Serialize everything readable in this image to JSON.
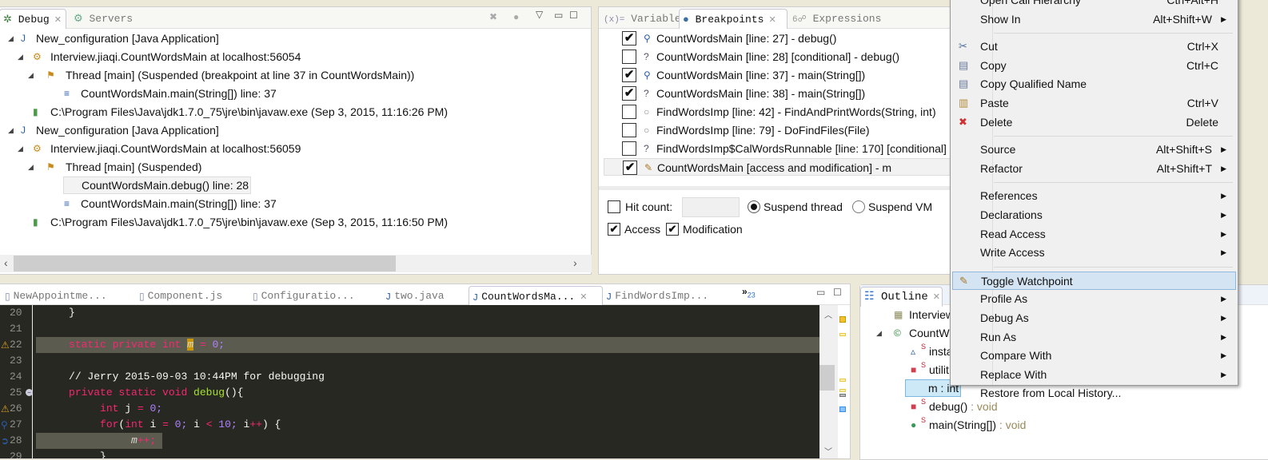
{
  "debug_panel": {
    "tabs": [
      {
        "label": "Debug",
        "icon": "bug-icon",
        "active": true
      },
      {
        "label": "Servers",
        "icon": "servers-icon",
        "active": false
      }
    ],
    "tree": [
      {
        "level": 0,
        "toggle": true,
        "icon": "java-app-icon",
        "label": "New_configuration [Java Application]"
      },
      {
        "level": 1,
        "toggle": true,
        "icon": "gears-icon",
        "label": "Interview.jiaqi.CountWordsMain at localhost:56054"
      },
      {
        "level": 2,
        "toggle": true,
        "icon": "thread-icon",
        "label": "Thread [main] (Suspended (breakpoint at line 37 in CountWordsMain))"
      },
      {
        "level": 3,
        "toggle": false,
        "icon": "stack-frame-icon",
        "label": "CountWordsMain.main(String[]) line: 37"
      },
      {
        "level": 1,
        "toggle": false,
        "icon": "process-icon",
        "label": "C:\\Program Files\\Java\\jdk1.7.0_75\\jre\\bin\\javaw.exe (Sep 3, 2015, 11:16:26 PM)"
      },
      {
        "level": 0,
        "toggle": true,
        "icon": "java-app-icon",
        "label": "New_configuration [Java Application]"
      },
      {
        "level": 1,
        "toggle": true,
        "icon": "gears-icon",
        "label": "Interview.jiaqi.CountWordsMain at localhost:56059"
      },
      {
        "level": 2,
        "toggle": true,
        "icon": "thread-icon",
        "label": "Thread [main] (Suspended)"
      },
      {
        "level": 3,
        "toggle": false,
        "icon": "stack-frame-icon",
        "label": "CountWordsMain.debug() line: 28",
        "selected": true
      },
      {
        "level": 3,
        "toggle": false,
        "icon": "stack-frame-icon",
        "label": "CountWordsMain.main(String[]) line: 37"
      },
      {
        "level": 1,
        "toggle": false,
        "icon": "process-icon",
        "label": "C:\\Program Files\\Java\\jdk1.7.0_75\\jre\\bin\\javaw.exe (Sep 3, 2015, 11:16:50 PM)"
      }
    ]
  },
  "breakpoints_panel": {
    "tabs": [
      {
        "label": "Variables",
        "icon": "variables-icon"
      },
      {
        "label": "Breakpoints",
        "icon": "breakpoints-icon",
        "active": true
      },
      {
        "label": "Expressions",
        "icon": "expressions-icon"
      }
    ],
    "items": [
      {
        "checked": true,
        "icon": "line-breakpoint-icon",
        "label": "CountWordsMain [line: 27] - debug()"
      },
      {
        "checked": false,
        "icon": "conditional-breakpoint-icon",
        "label": "CountWordsMain [line: 28] [conditional] - debug()"
      },
      {
        "checked": true,
        "icon": "line-breakpoint-icon",
        "label": "CountWordsMain [line: 37] - main(String[])"
      },
      {
        "checked": true,
        "icon": "conditional-breakpoint-icon",
        "label": "CountWordsMain [line: 38] - main(String[])"
      },
      {
        "checked": false,
        "icon": "disabled-breakpoint-icon",
        "label": "FindWordsImp [line: 42] - FindAndPrintWords(String, int)"
      },
      {
        "checked": false,
        "icon": "disabled-breakpoint-icon",
        "label": "FindWordsImp [line: 79] - DoFindFiles(File)"
      },
      {
        "checked": false,
        "icon": "conditional-breakpoint-icon",
        "label": "FindWordsImp$CalWordsRunnable [line: 170] [conditional]"
      },
      {
        "checked": true,
        "icon": "watchpoint-icon",
        "label": "CountWordsMain [access and modification] - m",
        "selected": true
      }
    ],
    "details": {
      "hit_count_label": "Hit count:",
      "hit_count_checked": false,
      "hit_count_value": "",
      "suspend_thread_label": "Suspend thread",
      "suspend_vm_label": "Suspend VM",
      "suspend_selected": "thread",
      "access_label": "Access",
      "access_checked": true,
      "modification_label": "Modification",
      "modification_checked": true
    }
  },
  "editor": {
    "tabs": [
      {
        "label": "NewAppointme...",
        "icon": "js-file-icon"
      },
      {
        "label": "Component.js",
        "icon": "js-file-icon"
      },
      {
        "label": "Configuratio...",
        "icon": "js-file-icon"
      },
      {
        "label": "two.java",
        "icon": "java-file-icon"
      },
      {
        "label": "CountWordsMa...",
        "icon": "java-file-icon",
        "active": true
      },
      {
        "label": "FindWordsImp...",
        "icon": "java-file-icon"
      }
    ],
    "overflow_count": "23",
    "lines": [
      {
        "n": "20",
        "tokens": [
          {
            "t": "\t}",
            "c": "plain"
          }
        ]
      },
      {
        "n": "21",
        "tokens": []
      },
      {
        "n": "22",
        "hl": "full",
        "marker": "warning-watchpoint-icon",
        "tokens": [
          {
            "t": "\t",
            "c": "plain"
          },
          {
            "t": "static private int ",
            "c": "keyword"
          },
          {
            "t": "m",
            "c": "field",
            "mark": true
          },
          {
            "t": " = ",
            "c": "op"
          },
          {
            "t": "0;",
            "c": "number"
          }
        ]
      },
      {
        "n": "23",
        "tokens": []
      },
      {
        "n": "24",
        "tokens": [
          {
            "t": "\t// Jerry 2015-09-03 10:44PM for debugging",
            "c": "comment"
          }
        ]
      },
      {
        "n": "25",
        "fold": true,
        "tokens": [
          {
            "t": "\t",
            "c": "plain"
          },
          {
            "t": "private static void ",
            "c": "keyword"
          },
          {
            "t": "debug",
            "c": "func"
          },
          {
            "t": "(){",
            "c": "plain"
          }
        ]
      },
      {
        "n": "26",
        "marker": "warning-icon",
        "tokens": [
          {
            "t": "\t\t",
            "c": "plain"
          },
          {
            "t": "int ",
            "c": "keyword"
          },
          {
            "t": "j",
            "c": "plain"
          },
          {
            "t": " = ",
            "c": "op"
          },
          {
            "t": "0;",
            "c": "number"
          }
        ]
      },
      {
        "n": "27",
        "marker": "breakpoint-icon",
        "tokens": [
          {
            "t": "\t\t",
            "c": "plain"
          },
          {
            "t": "for",
            "c": "keyword"
          },
          {
            "t": "(",
            "c": "plain"
          },
          {
            "t": "int ",
            "c": "keyword"
          },
          {
            "t": "i",
            "c": "plain"
          },
          {
            "t": " = ",
            "c": "op"
          },
          {
            "t": "0; ",
            "c": "number"
          },
          {
            "t": "i ",
            "c": "plain"
          },
          {
            "t": "< ",
            "c": "op"
          },
          {
            "t": "10; ",
            "c": "number"
          },
          {
            "t": "i",
            "c": "plain"
          },
          {
            "t": "++",
            "c": "op"
          },
          {
            "t": ") {",
            "c": "plain"
          }
        ]
      },
      {
        "n": "28",
        "hl": "partial",
        "marker": "current-line-breakpoint-icon",
        "tokens": [
          {
            "t": "\t\t\t",
            "c": "plain"
          },
          {
            "t": "m",
            "c": "field"
          },
          {
            "t": "++;",
            "c": "op"
          }
        ]
      },
      {
        "n": "29",
        "tokens": [
          {
            "t": "\t\t}",
            "c": "plain"
          }
        ]
      }
    ]
  },
  "outline": {
    "tab_label": "Outline",
    "items": [
      {
        "level": 1,
        "icon": "package-icon",
        "label": "Interview",
        "suffix": ""
      },
      {
        "level": 1,
        "toggle": true,
        "icon": "class-icon",
        "label": "CountW",
        "suffix": ""
      },
      {
        "level": 2,
        "icon": "protected-field-icon",
        "static": "S",
        "label": "insta",
        "suffix": ""
      },
      {
        "level": 2,
        "icon": "private-field-icon",
        "static": "S",
        "label": "utilit",
        "suffix": ""
      },
      {
        "level": 2,
        "icon": "private-field-warning-icon",
        "static": "S",
        "label": "m : int",
        "suffix": "",
        "selected": true
      },
      {
        "level": 2,
        "icon": "private-method-warning-icon",
        "static": "S",
        "label": "debug()",
        "suffix": " : void"
      },
      {
        "level": 2,
        "icon": "public-method-icon",
        "static": "S",
        "label": "main(String[])",
        "suffix": " : void"
      }
    ]
  },
  "context_menu": {
    "items": [
      {
        "label": "Open Call Hierarchy",
        "shortcut": "Ctrl+Alt+H"
      },
      {
        "label": "Show In",
        "shortcut": "Alt+Shift+W",
        "submenu": true
      },
      {
        "sep": true
      },
      {
        "label": "Cut",
        "shortcut": "Ctrl+X",
        "icon": "cut-icon"
      },
      {
        "label": "Copy",
        "shortcut": "Ctrl+C",
        "icon": "copy-icon"
      },
      {
        "label": "Copy Qualified Name",
        "shortcut": "",
        "icon": "copy-qualified-name-icon"
      },
      {
        "label": "Paste",
        "shortcut": "Ctrl+V",
        "icon": "paste-icon"
      },
      {
        "label": "Delete",
        "shortcut": "Delete",
        "icon": "delete-icon"
      },
      {
        "sep": true
      },
      {
        "label": "Source",
        "shortcut": "Alt+Shift+S",
        "submenu": true
      },
      {
        "label": "Refactor",
        "shortcut": "Alt+Shift+T",
        "submenu": true
      },
      {
        "sep": true
      },
      {
        "label": "References",
        "submenu": true
      },
      {
        "label": "Declarations",
        "submenu": true
      },
      {
        "label": "Read Access",
        "submenu": true
      },
      {
        "label": "Write Access",
        "submenu": true
      },
      {
        "sep": true
      },
      {
        "label": "Toggle Watchpoint",
        "icon": "watchpoint-icon",
        "selected": true
      },
      {
        "label": "Profile As",
        "submenu": true
      },
      {
        "label": "Debug As",
        "submenu": true
      },
      {
        "label": "Run As",
        "submenu": true
      },
      {
        "label": "Compare With",
        "submenu": true
      },
      {
        "label": "Replace With",
        "submenu": true
      },
      {
        "label": "Restore from Local History..."
      }
    ]
  },
  "colors": {
    "editor_bg": "#272822",
    "keyword": "#f92672",
    "number": "#ae81ff",
    "function": "#a6e22e",
    "menu_highlight": "#d5e4f2"
  }
}
